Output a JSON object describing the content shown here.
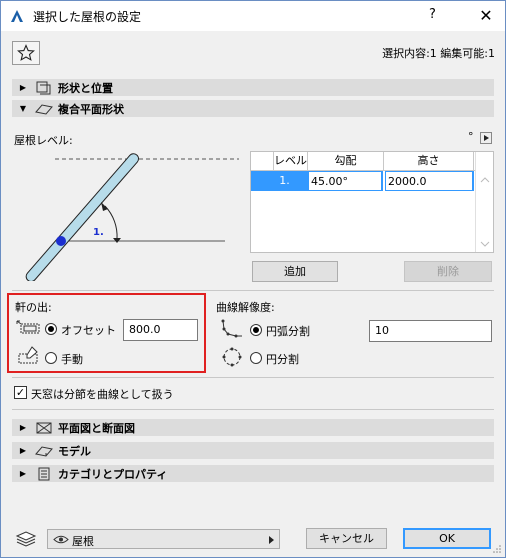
{
  "window": {
    "title": "選択した屋根の設定",
    "help": "?",
    "close": "✕"
  },
  "toolbar": {
    "favorites_icon": "star-icon",
    "selection_info": "選択内容:1 編集可能:1"
  },
  "sections": {
    "shape_position": "形状と位置",
    "multi_plane": "複合平面形状",
    "plan_section": "平面図と断面図",
    "model": "モデル",
    "category": "カテゴリとプロパティ"
  },
  "roof_levels": {
    "label": "屋根レベル:",
    "degree_mark": "°",
    "diagram_level_label": "1.",
    "table": {
      "headers": [
        "レベル",
        "勾配",
        "高さ"
      ],
      "rows": [
        {
          "level": "1.",
          "pitch": "45.00°",
          "height": "2000.0"
        }
      ]
    },
    "add_button": "追加",
    "delete_button": "削除"
  },
  "eaves": {
    "label": "軒の出:",
    "offset_label": "オフセット",
    "offset_value": "800.0",
    "manual_label": "手動",
    "selected": "offset"
  },
  "curve": {
    "label": "曲線解像度:",
    "arc_label": "円弧分割",
    "arc_value": "10",
    "circle_label": "円分割",
    "selected": "arc"
  },
  "skylight": {
    "label": "天窓は分節を曲線として扱う",
    "checked": true
  },
  "footer": {
    "layer_value": "屋根",
    "cancel_button": "キャンセル",
    "ok_button": "OK"
  },
  "colors": {
    "accent": "#3399ff",
    "highlight_box": "#e02020",
    "roof_fill": "#b7dcea",
    "pivot_dot": "#1b2fd0"
  }
}
